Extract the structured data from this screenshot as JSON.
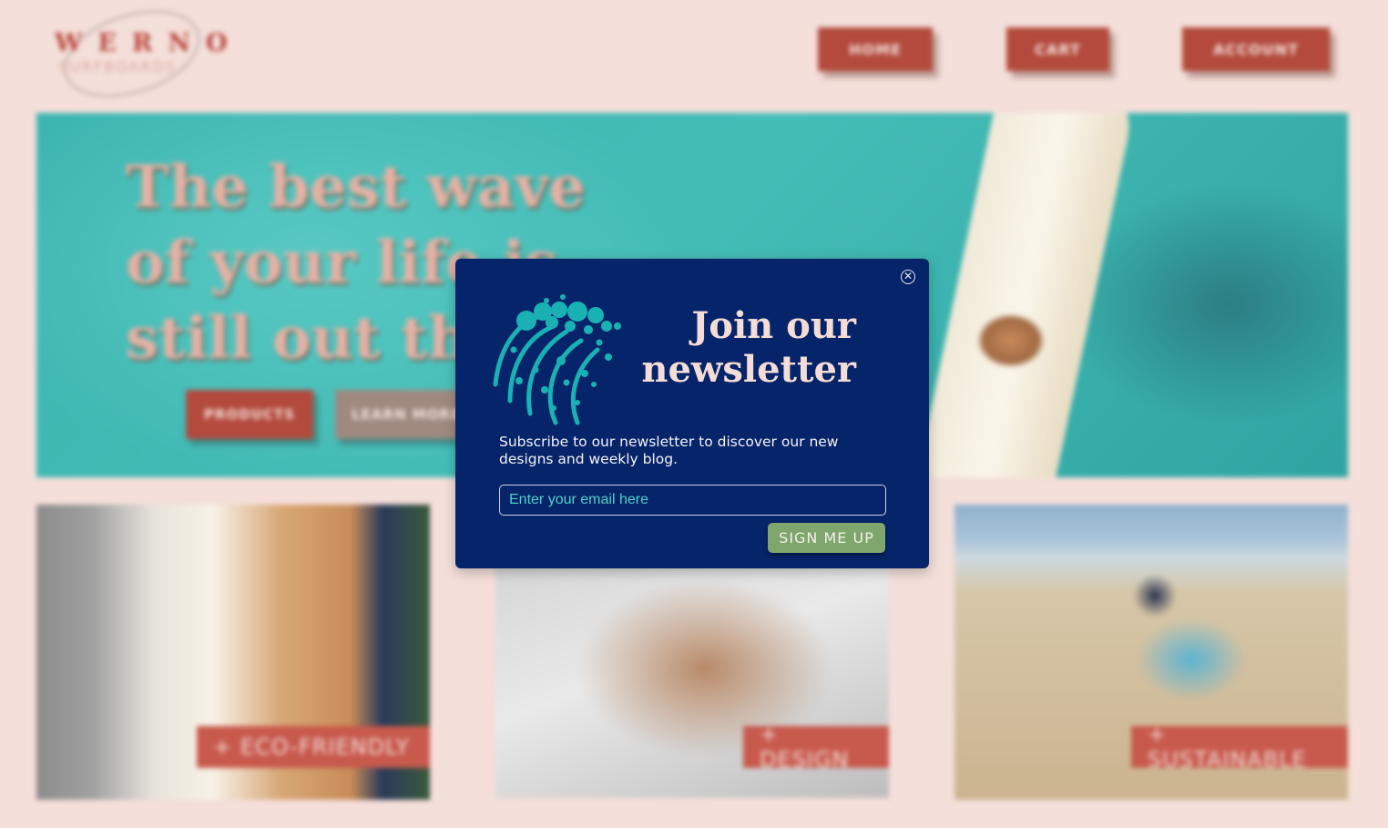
{
  "brand": {
    "logo_name": "WERNO",
    "logo_tagline": "SURFBOARDS"
  },
  "nav": {
    "home": "HOME",
    "cart": "CART",
    "account": "ACCOUNT"
  },
  "hero": {
    "title": "The best wave\nof your life is\nstill out there",
    "products_button": "PRODUCTS",
    "learn_more_button": "LEARN MORE"
  },
  "cards": [
    {
      "tag": "+ ECO-FRIENDLY"
    },
    {
      "tag": "+ DESIGN"
    },
    {
      "tag": "+ SUSTAINABLE"
    }
  ],
  "modal": {
    "title": "Join our\nnewsletter",
    "description": "Subscribe to our newsletter to discover our new designs and weekly blog.",
    "email_placeholder": "Enter your email here",
    "email_value": "",
    "submit_label": "SIGN ME UP",
    "close_icon": "close-circle-icon",
    "wave_icon": "wave-icon"
  },
  "colors": {
    "page_background": "#f4dfda",
    "brand_red": "#b34a3d",
    "modal_background": "#062469",
    "accent_teal": "#19b1b4",
    "signup_green": "#7ea66d",
    "title_pink": "#f4ddd7"
  }
}
